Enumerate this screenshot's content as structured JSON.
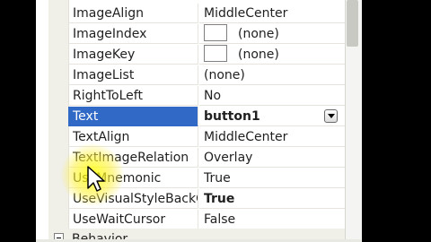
{
  "properties": [
    {
      "name": "ImageAlign",
      "value": "MiddleCenter"
    },
    {
      "name": "ImageIndex",
      "value": "(none)",
      "swatch": true
    },
    {
      "name": "ImageKey",
      "value": "(none)",
      "swatch": true
    },
    {
      "name": "ImageList",
      "value": "(none)"
    },
    {
      "name": "RightToLeft",
      "value": "No"
    },
    {
      "name": "Text",
      "value": "button1",
      "selected": true
    },
    {
      "name": "TextAlign",
      "value": "MiddleCenter"
    },
    {
      "name": "TextImageRelation",
      "value": "Overlay"
    },
    {
      "name": "UseMnemonic",
      "value": "True"
    },
    {
      "name": "UseVisualStyleBackColor",
      "value": "True"
    },
    {
      "name": "UseWaitCursor",
      "value": "False"
    }
  ],
  "category": {
    "label": "Behavior"
  },
  "colors": {
    "selection": "#3169c6",
    "highlight": "#ffff00"
  },
  "icons": {
    "dropdown": "chevron-down-icon",
    "collapse": "minus-box-icon",
    "cursor": "arrow-cursor-icon"
  }
}
